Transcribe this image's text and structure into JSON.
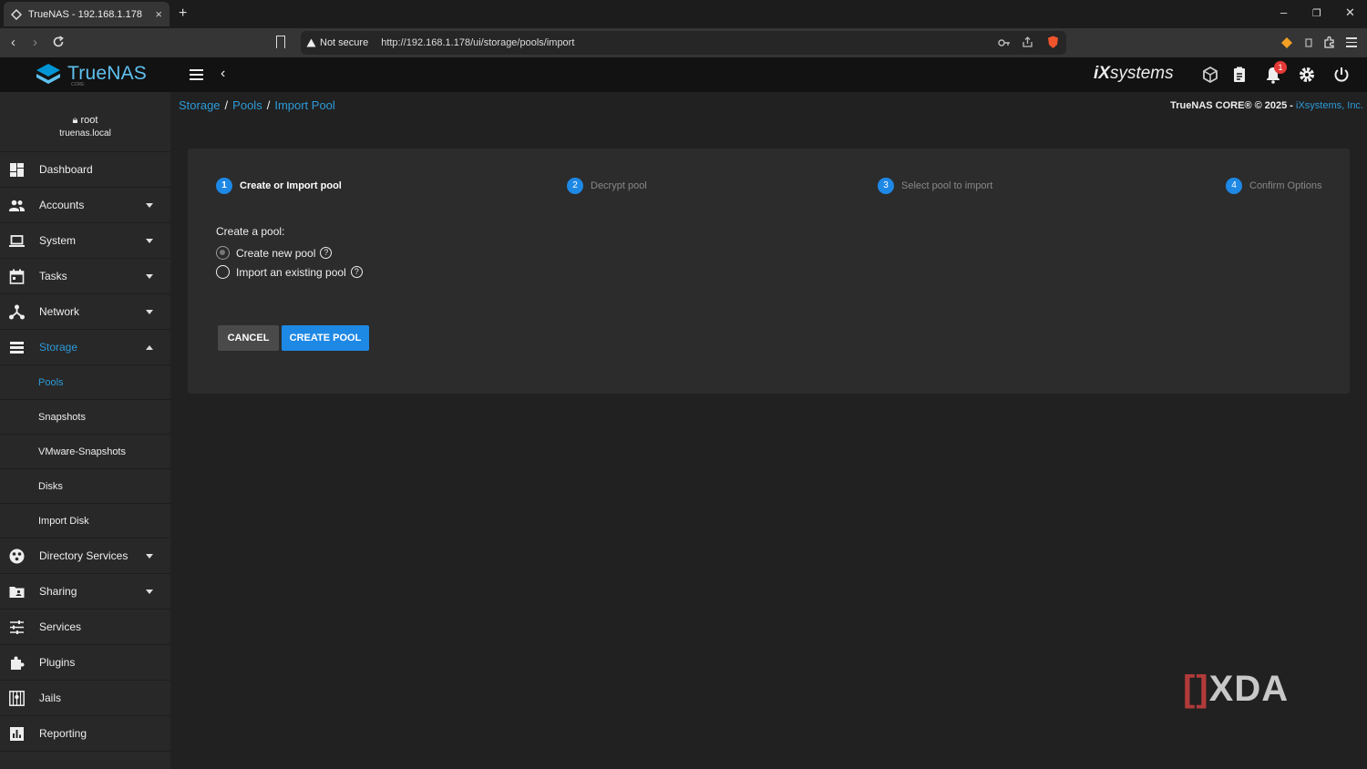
{
  "browser": {
    "tab_title": "TrueNAS - 192.168.1.178",
    "tab_close": "×",
    "new_tab": "+",
    "not_secure": "Not secure",
    "url": "http://192.168.1.178/ui/storage/pools/import",
    "window_minimize": "–",
    "window_maximize": "❐",
    "window_close": "✕"
  },
  "header": {
    "logo_text": "TrueNAS",
    "logo_sub": "CORE",
    "vendor_brand": "iXsystems",
    "vendor_brand_prefix": "iX",
    "vendor_brand_suffix": "systems",
    "notification_count": "1"
  },
  "user": {
    "name": "root",
    "host": "truenas.local"
  },
  "sidebar": {
    "items": [
      {
        "label": "Dashboard"
      },
      {
        "label": "Accounts"
      },
      {
        "label": "System"
      },
      {
        "label": "Tasks"
      },
      {
        "label": "Network"
      },
      {
        "label": "Storage"
      },
      {
        "label": "Directory Services"
      },
      {
        "label": "Sharing"
      },
      {
        "label": "Services"
      },
      {
        "label": "Plugins"
      },
      {
        "label": "Jails"
      },
      {
        "label": "Reporting"
      }
    ],
    "storage_sub": [
      {
        "label": "Pools"
      },
      {
        "label": "Snapshots"
      },
      {
        "label": "VMware-Snapshots"
      },
      {
        "label": "Disks"
      },
      {
        "label": "Import Disk"
      }
    ]
  },
  "breadcrumb": {
    "items": [
      "Storage",
      "Pools",
      "Import Pool"
    ],
    "sep": "/"
  },
  "copyright": {
    "text": "TrueNAS CORE® © 2025 - ",
    "company": "iXsystems, Inc."
  },
  "wizard": {
    "steps": [
      {
        "num": "1",
        "label": "Create or Import pool"
      },
      {
        "num": "2",
        "label": "Decrypt pool"
      },
      {
        "num": "3",
        "label": "Select pool to import"
      },
      {
        "num": "4",
        "label": "Confirm Options"
      }
    ],
    "field_label": "Create a pool:",
    "options": [
      {
        "label": "Create new pool",
        "checked": true
      },
      {
        "label": "Import an existing pool",
        "checked": false
      }
    ],
    "help_glyph": "?",
    "cancel_label": "CANCEL",
    "create_label": "CREATE POOL"
  },
  "watermark": {
    "bracket": "[]",
    "text": "XDA"
  },
  "colors": {
    "accent": "#1e88e5",
    "link": "#2d9ad8",
    "badge": "#e53935"
  }
}
